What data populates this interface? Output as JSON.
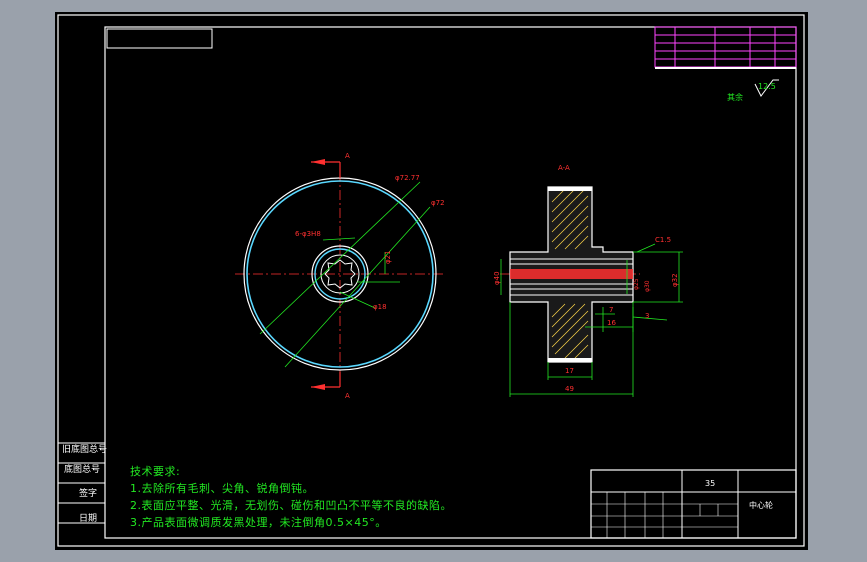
{
  "drawing": {
    "part_name": "中心轮",
    "material": "35",
    "surface_finish": "其余",
    "roughness_value": "12.5",
    "view_a_label": "A",
    "view_aa_label": "A-A"
  },
  "side_labels": [
    "旧底图总号",
    "底图总号",
    "签字",
    "日期"
  ],
  "technical_requirements": {
    "heading": "技术要求:",
    "items": [
      "1.去除所有毛刺、尖角、锐角倒钝。",
      "2.表面应平整、光滑，无划伤、碰伤和凹凸不平等不良的缺陷。",
      "3.产品表面微调质发黑处理，未注倒角0.5×45°。"
    ]
  },
  "dimensions": {
    "outer_dia": "φ72",
    "tip_dia": "φ72.77",
    "holes": "6-φ3H8",
    "spline_a": "φ18",
    "spline_b": "φ21",
    "width_total": "49",
    "width_a": "17",
    "width_b": "16",
    "width_c": "7",
    "width_d": "3",
    "hub_dia": "φ32",
    "bore_1": "φ25",
    "bore_2": "φ30",
    "chamfer": "C1.5",
    "height": "φ40"
  }
}
